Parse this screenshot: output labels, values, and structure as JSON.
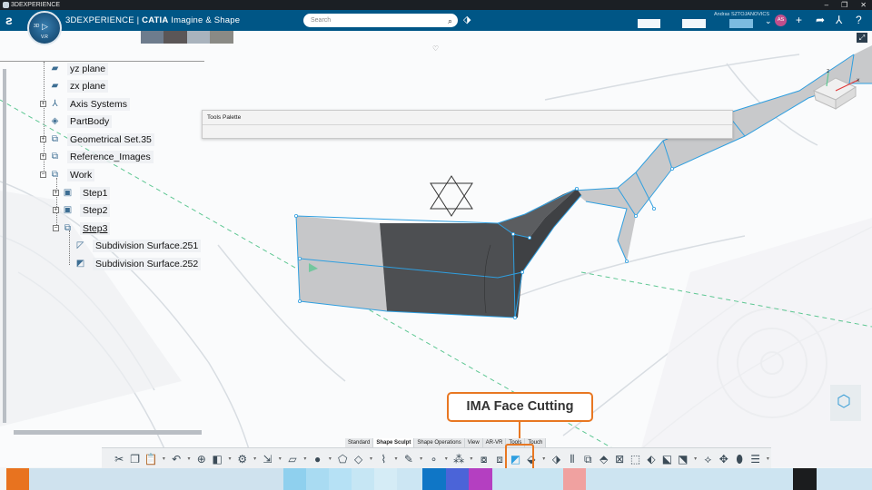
{
  "window": {
    "title": "3DEXPERIENCE",
    "buttons": [
      "–",
      "❐",
      "✕"
    ]
  },
  "appbar": {
    "brand_prefix": "3DEXPERIENCE | ",
    "brand_app": "CATIA",
    "brand_suffix": " Imagine & Shape",
    "search_placeholder": "Search",
    "user": "Andras SZTOJANOVICS",
    "avatar": "AS",
    "compass_version": "V.R"
  },
  "tree": {
    "nodes": [
      {
        "label": "yz plane",
        "icon": "plane-icon"
      },
      {
        "label": "zx plane",
        "icon": "plane-icon"
      },
      {
        "label": "Axis Systems",
        "icon": "axis-systems-icon"
      },
      {
        "label": "PartBody",
        "icon": "partbody-icon"
      },
      {
        "label": "Geometrical Set.35",
        "icon": "geometrical-set-icon"
      },
      {
        "label": "Reference_Images",
        "icon": "geometrical-set-icon"
      },
      {
        "label": "Work",
        "icon": "geometrical-set-icon"
      },
      {
        "label": "Step1",
        "icon": "step-icon"
      },
      {
        "label": "Step2",
        "icon": "step-icon"
      },
      {
        "label": "Step3",
        "icon": "step-icon"
      },
      {
        "label": "Subdivision Surface.251",
        "icon": "subdivision-surface-icon"
      },
      {
        "label": "Subdivision Surface.252",
        "icon": "subdivision-surface-icon"
      }
    ]
  },
  "tools_palette": {
    "title": "Tools Palette"
  },
  "callout": {
    "text": "IMA Face Cutting"
  },
  "action_bar": {
    "tabs": [
      "Standard",
      "Shape Sculpt",
      "Shape Operations",
      "View",
      "AR-VR",
      "Tools",
      "Touch"
    ],
    "active_tab": "Shape Sculpt"
  },
  "colors": {
    "appbar": "#005686",
    "accent": "#e87722",
    "selection": "#2f9fe0"
  }
}
